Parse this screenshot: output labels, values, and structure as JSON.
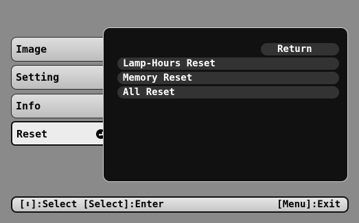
{
  "menu": {
    "tabs": [
      {
        "label": "Image",
        "active": false
      },
      {
        "label": "Setting",
        "active": false
      },
      {
        "label": "Info",
        "active": false
      },
      {
        "label": "Reset",
        "active": true
      }
    ],
    "active_tab_icon": "enter-icon"
  },
  "panel": {
    "return_label": "Return",
    "items": [
      {
        "label": "Lamp-Hours Reset"
      },
      {
        "label": "Memory Reset"
      },
      {
        "label": "All Reset"
      }
    ]
  },
  "status_bar": {
    "left": "[⬍]:Select [Select]:Enter",
    "right": "[Menu]:Exit"
  },
  "colors": {
    "background": "#8a8a8a",
    "panel": "#111111",
    "item": "#333333",
    "tab": "#cfcfcf"
  }
}
